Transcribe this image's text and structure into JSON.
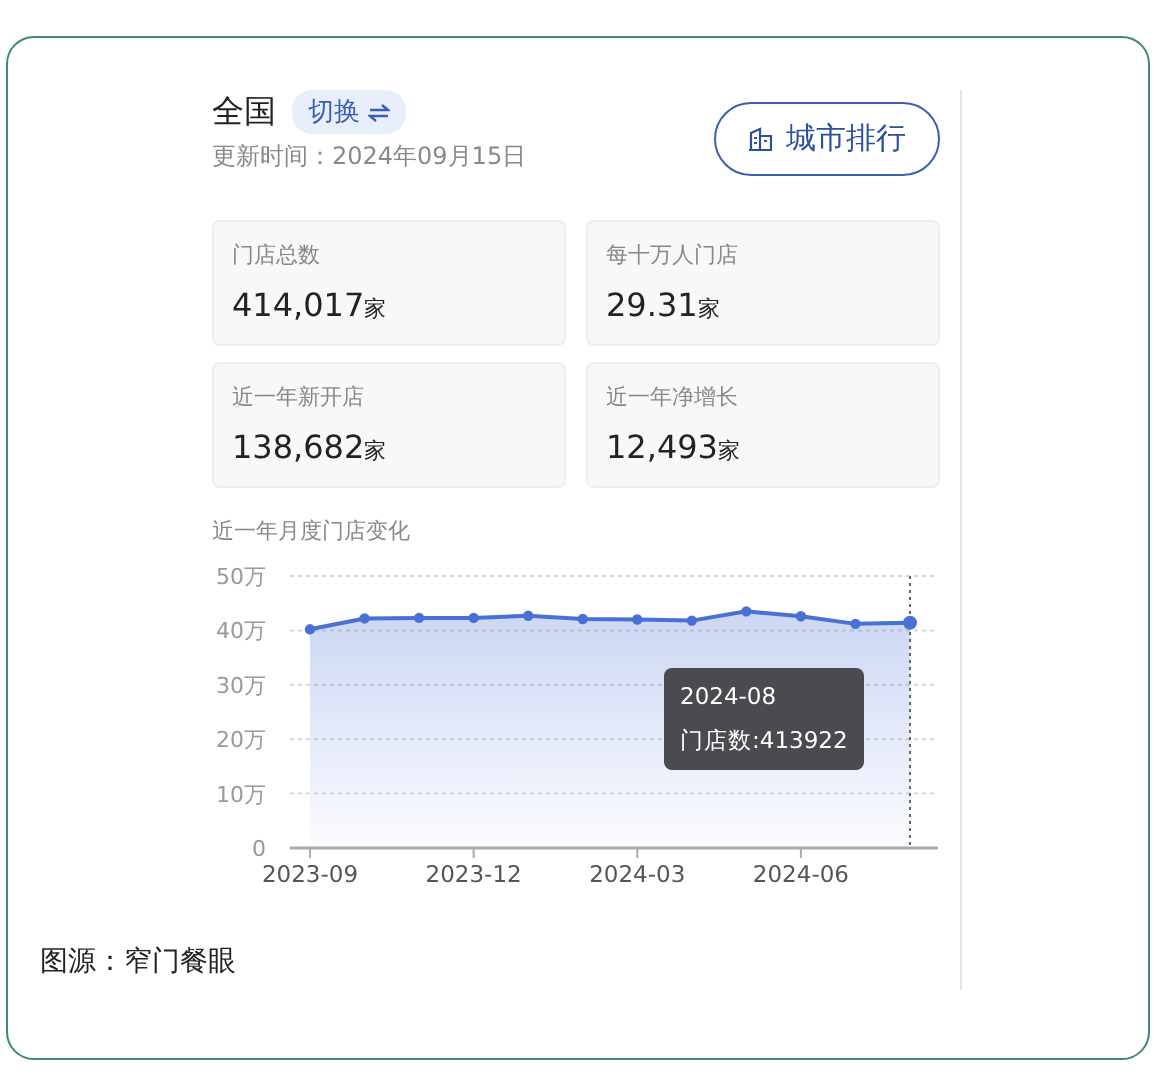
{
  "header": {
    "region": "全国",
    "switch_label": "切换",
    "updated": "更新时间：2024年09月15日",
    "ranking_button": "城市排行"
  },
  "stats": [
    {
      "label": "门店总数",
      "value": "414,017",
      "unit": "家"
    },
    {
      "label": "每十万人门店",
      "value": "29.31",
      "unit": "家"
    },
    {
      "label": "近一年新开店",
      "value": "138,682",
      "unit": "家"
    },
    {
      "label": "近一年净增长",
      "value": "12,493",
      "unit": "家"
    }
  ],
  "chart": {
    "title": "近一年月度门店变化",
    "tooltip": {
      "title": "2024-08",
      "text": "门店数:413922"
    },
    "chart_data": {
      "type": "area",
      "categories": [
        "2023-09",
        null,
        null,
        "2023-12",
        null,
        null,
        "2024-03",
        null,
        null,
        "2024-06",
        null,
        null
      ],
      "series": [
        {
          "color": "#4a6fd6",
          "values": [
            40.2,
            42.2,
            42.3,
            42.3,
            42.7,
            42.1,
            42.0,
            41.8,
            43.5,
            42.6,
            41.2,
            41.4
          ]
        }
      ],
      "ylim": [
        0,
        50
      ],
      "grid": true,
      "yticks": [
        {
          "value": 0,
          "label": "0"
        },
        {
          "value": 10,
          "label": "10万"
        },
        {
          "value": 20,
          "label": "20万"
        },
        {
          "value": 30,
          "label": "30万"
        },
        {
          "value": 40,
          "label": "40万"
        },
        {
          "value": 50,
          "label": "50万"
        }
      ]
    }
  },
  "caption": "图源：窄门餐眼"
}
